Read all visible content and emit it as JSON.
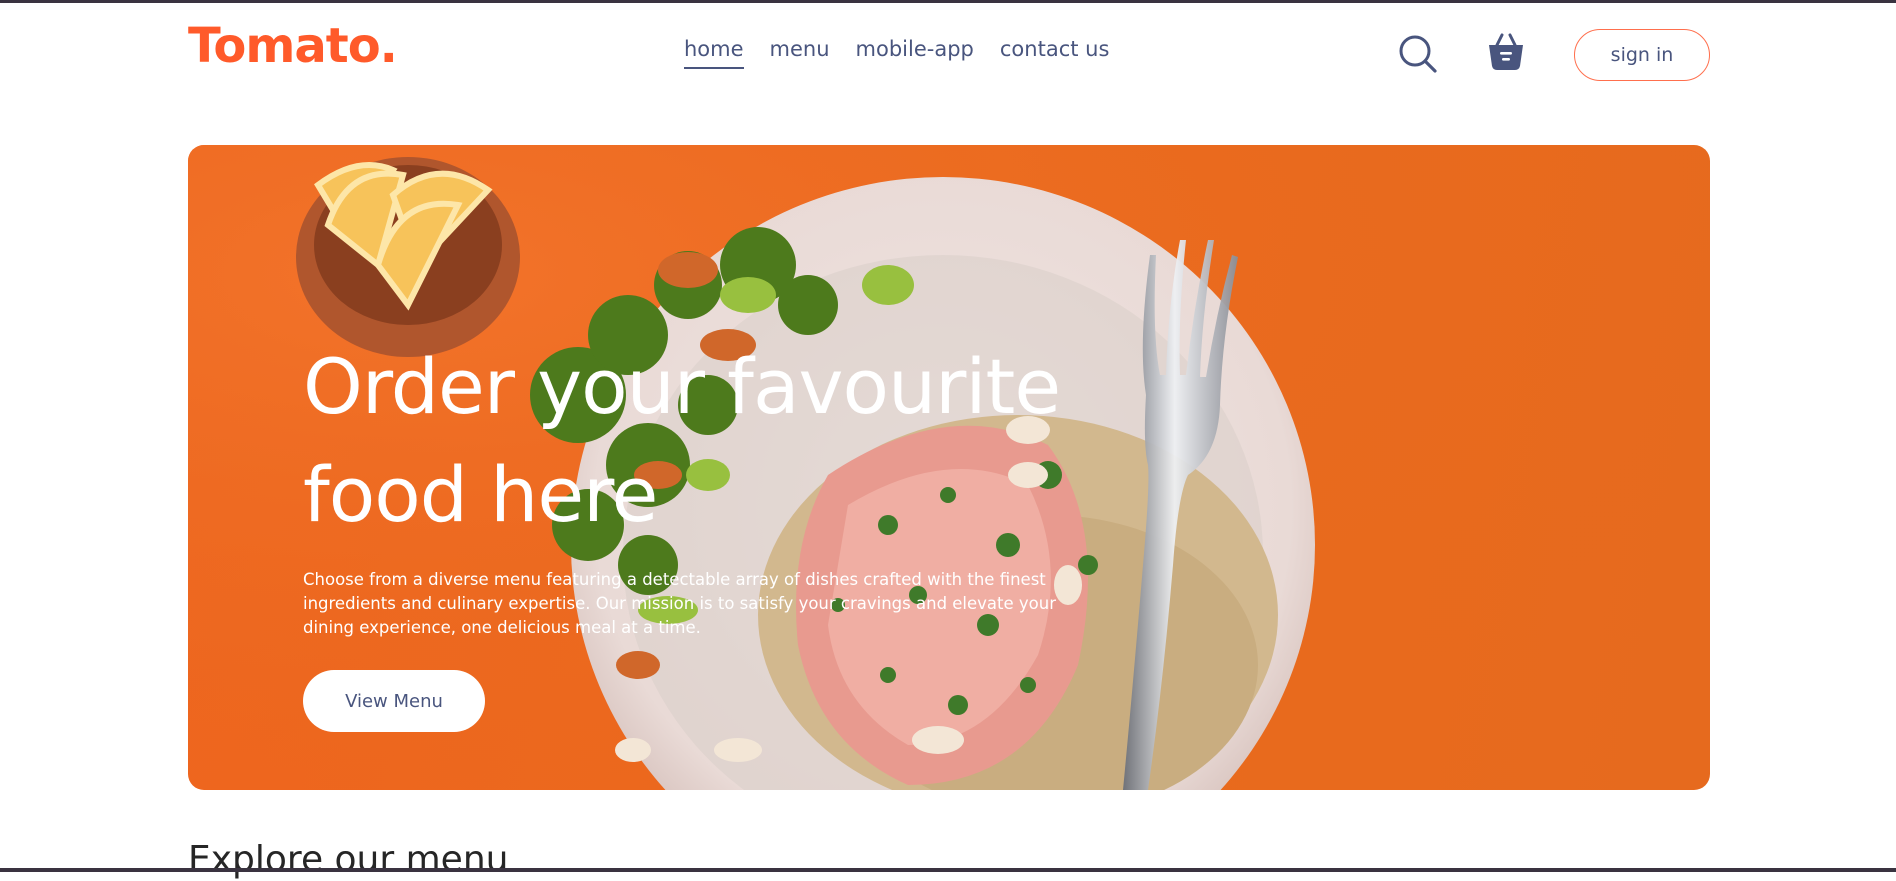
{
  "brand": {
    "logo_text": "Tomato.",
    "accent_color": "#ff5a2a"
  },
  "navbar": {
    "links": [
      {
        "label": "home",
        "active": true
      },
      {
        "label": "menu",
        "active": false
      },
      {
        "label": "mobile-app",
        "active": false
      },
      {
        "label": "contact us",
        "active": false
      }
    ],
    "icons": [
      "search-icon",
      "basket-icon"
    ],
    "signin_label": "sign in"
  },
  "hero": {
    "title": "Order your favourite food here",
    "description": "Choose from a diverse menu featuring a detectable array of dishes crafted with the finest ingredients and culinary expertise. Our mission is to satisfy your cravings and elevate your dining experience, one delicious meal at a time.",
    "button_label": "View Menu",
    "background_color": "#ee6a1e"
  },
  "explore": {
    "title": "Explore our menu"
  }
}
